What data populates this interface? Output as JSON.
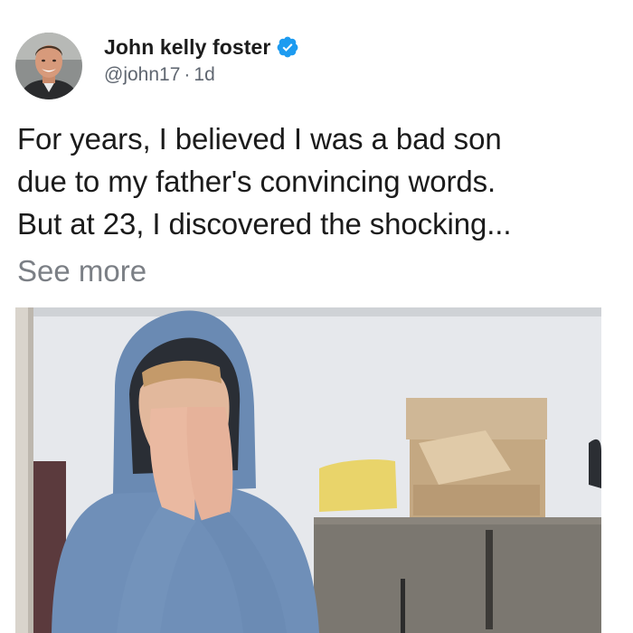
{
  "post": {
    "author": {
      "display_name": "John kelly foster",
      "handle": "@john17",
      "separator": "·",
      "time_ago": "1d",
      "verified": true,
      "avatar_icon": "profile-photo"
    },
    "text_lines": [
      "For years, I believed I was a bad son",
      "due to my father's convincing words.",
      "But at 23, I discovered the shocking..."
    ],
    "see_more_label": "See more",
    "media": {
      "type": "photo"
    }
  },
  "colors": {
    "verified_badge": "#1d9bf0",
    "name_text": "#1c1c1c",
    "meta_text": "#5f6670",
    "see_more_text": "#7b7f85"
  }
}
